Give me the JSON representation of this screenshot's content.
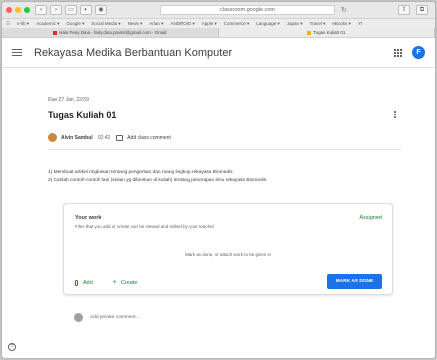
{
  "browser": {
    "url": "classroom.google.com",
    "bookmarks": [
      "e-lib ▾",
      "Academic ▾",
      "Google ▾",
      "Social Media ▾",
      "News ▾",
      "Arlan ▾",
      "ANDROID ▾",
      "Apple ▾",
      "Commerce ▾",
      "Language ▾",
      "Japan ▾",
      "Travel ▾",
      "eBooks ▾",
      "Y!"
    ],
    "tabs": [
      {
        "title": "Halo Feny Dina - farly.dina.pramit@gmail.com - Gmail",
        "favicon_color": "#d93025"
      },
      {
        "title": "Tugas Kuliah 01",
        "favicon_color": "#f6b400"
      }
    ]
  },
  "header": {
    "title": "Rekayasa Medika Berbantuan Komputer",
    "avatar_letter": "F"
  },
  "assignment": {
    "due": "Due 27 Jan, 23:59",
    "title": "Tugas Kuliah 01",
    "author": "Alvin Sambul",
    "time": "02:42",
    "add_comment": "Add class comment",
    "lines": [
      "1) Membuat artikel ringkasan tentang pengertian dan ruang lingkup rekayasa Biomedis.",
      "2) Carilah contoh-contoh lain (selain yg diberikan di kuliah) tentang penerapan ilmu rekayasa Biomedis."
    ]
  },
  "your_work": {
    "label": "Your work",
    "status": "Assigned",
    "subtitle": "Files that you add or create can be viewed and edited by your teacher",
    "hint": "Mark as done, or attach work to be given in",
    "add_label": "Add",
    "create_label": "Create",
    "mark_done_label": "MARK AS DONE"
  },
  "private_comment": {
    "placeholder": "Add private comment..."
  },
  "colors": {
    "accent": "#1a73e8",
    "status_green": "#188038"
  }
}
